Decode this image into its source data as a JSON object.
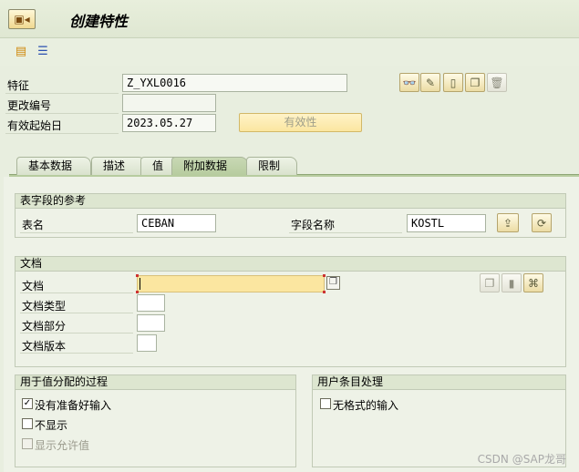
{
  "header": {
    "title": "创建特性"
  },
  "form": {
    "characteristic": {
      "label": "特征",
      "value": "Z_YXL0016"
    },
    "change_number": {
      "label": "更改编号",
      "value": ""
    },
    "valid_from": {
      "label": "有效起始日",
      "value": "2023.05.27"
    },
    "validity_button": "有效性"
  },
  "tabs": [
    "基本数据",
    "描述",
    "值",
    "附加数据",
    "限制"
  ],
  "active_tab": "附加数据",
  "table_ref": {
    "title": "表字段的参考",
    "table_label": "表名",
    "table_value": "CEBAN",
    "field_label": "字段名称",
    "field_value": "KOSTL"
  },
  "document": {
    "title": "文档",
    "doc_label": "文档",
    "doc_value": "",
    "type_label": "文档类型",
    "part_label": "文档部分",
    "version_label": "文档版本"
  },
  "value_assignment": {
    "title": "用于值分配的过程",
    "options": [
      {
        "label": "没有准备好输入",
        "checked": true,
        "disabled": false
      },
      {
        "label": "不显示",
        "checked": false,
        "disabled": false
      },
      {
        "label": "显示允许值",
        "checked": false,
        "disabled": true
      }
    ]
  },
  "user_entry": {
    "title": "用户条目处理",
    "options": [
      {
        "label": "无格式的输入",
        "checked": false
      }
    ]
  },
  "watermark": "CSDN @SAP龙哥"
}
